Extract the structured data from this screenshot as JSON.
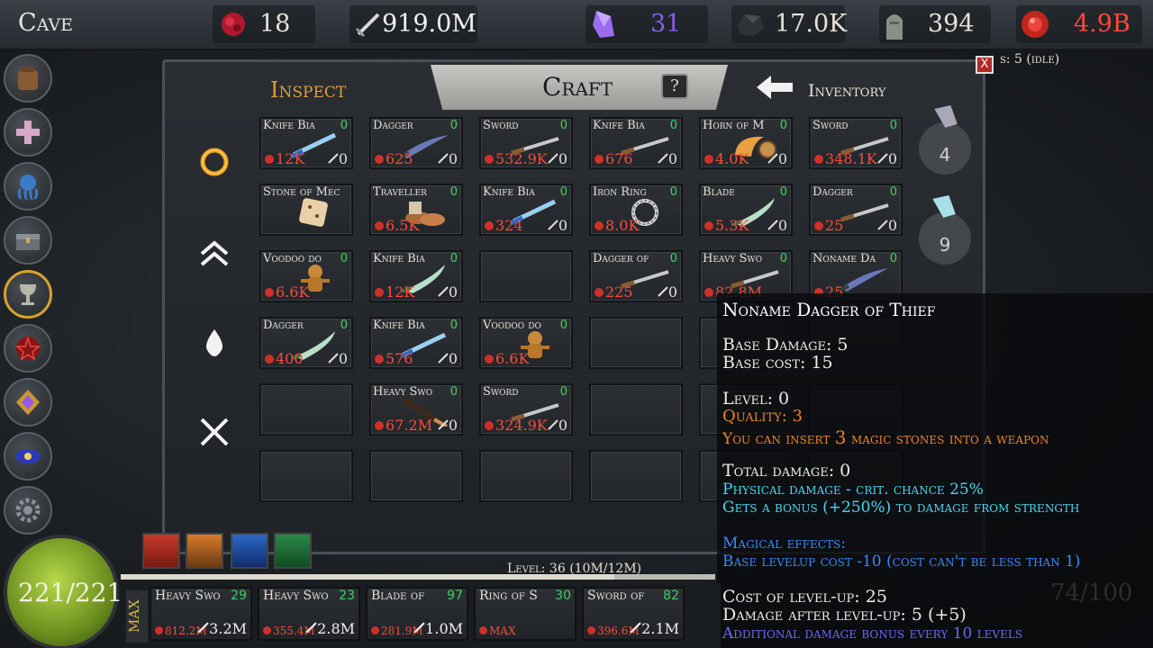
{
  "topbar": {
    "location": "Cave",
    "resources": [
      {
        "icon": "blood-drop-icon",
        "value": "18",
        "color": "#e8e2d6"
      },
      {
        "icon": "sword-icon",
        "value": "919.0M",
        "color": "#f2f2f2"
      },
      {
        "icon": "purple-crystal-icon",
        "value": "31",
        "color": "#8a5cf0"
      },
      {
        "icon": "ore-rock-icon",
        "value": "17.0K",
        "color": "#e8e2d6"
      },
      {
        "icon": "tombstone-icon",
        "value": "394",
        "color": "#e8e2d6"
      },
      {
        "icon": "red-orb-icon",
        "value": "4.9B",
        "color": "#ff4a3a"
      }
    ],
    "status_fragment": "s: 5 (idle)"
  },
  "sidebar": {
    "items": [
      {
        "icon": "backpack-icon"
      },
      {
        "icon": "cross-icon"
      },
      {
        "icon": "octopus-icon"
      },
      {
        "icon": "chest-icon"
      },
      {
        "icon": "goblet-icon",
        "active": true
      },
      {
        "icon": "pentagram-icon"
      },
      {
        "icon": "purple-gem-icon"
      },
      {
        "icon": "galaxy-icon"
      },
      {
        "icon": "gear-icon"
      }
    ]
  },
  "panel": {
    "tabs": {
      "inspect": "Inspect",
      "craft": "Craft",
      "help": "?",
      "inventory": "Inventory"
    },
    "close": "X",
    "actions": [
      "ring-icon",
      "upgrade-chevrons-icon",
      "drop-icon",
      "x-icon"
    ]
  },
  "grid": {
    "rows": [
      [
        {
          "name": "Knife Bia",
          "lvl": "0",
          "cost": "12K",
          "dmg": "0",
          "art": "knife"
        },
        {
          "name": "Dagger",
          "lvl": "0",
          "cost": "625",
          "dmg": "0",
          "art": "dagger"
        },
        {
          "name": "Sword",
          "lvl": "0",
          "cost": "532.9K",
          "dmg": "0",
          "art": "sword"
        },
        {
          "name": "Knife Bia",
          "lvl": "0",
          "cost": "676",
          "dmg": "0",
          "art": "sword"
        },
        {
          "name": "Horn of M",
          "lvl": "0",
          "cost": "4.0K",
          "dmg": "0",
          "art": "horn"
        },
        {
          "name": "Sword",
          "lvl": "0",
          "cost": "348.1K",
          "dmg": "0",
          "art": "sword"
        }
      ],
      [
        {
          "name": "Stone of Mec",
          "lvl": "",
          "cost": "",
          "dmg": "",
          "art": "dice"
        },
        {
          "name": "Traveller",
          "lvl": "0",
          "cost": "6.5K",
          "dmg": "",
          "art": "boots"
        },
        {
          "name": "Knife Bia",
          "lvl": "0",
          "cost": "324",
          "dmg": "0",
          "art": "knife"
        },
        {
          "name": "Iron Ring",
          "lvl": "0",
          "cost": "8.0K",
          "dmg": "",
          "art": "ring"
        },
        {
          "name": "Blade",
          "lvl": "0",
          "cost": "5.3K",
          "dmg": "0",
          "art": "blade"
        },
        {
          "name": "Dagger",
          "lvl": "0",
          "cost": "25",
          "dmg": "0",
          "art": "sword"
        }
      ],
      [
        {
          "name": "Voodoo do",
          "lvl": "0",
          "cost": "6.6K",
          "dmg": "",
          "art": "doll"
        },
        {
          "name": "Knife Bia",
          "lvl": "0",
          "cost": "12K",
          "dmg": "0",
          "art": "blade"
        },
        {
          "name": "",
          "lvl": "",
          "cost": "",
          "dmg": "",
          "art": ""
        },
        {
          "name": "Dagger of",
          "lvl": "0",
          "cost": "225",
          "dmg": "0",
          "art": "sword"
        },
        {
          "name": "Heavy Swo",
          "lvl": "0",
          "cost": "82.8M",
          "dmg": "",
          "art": "sword"
        },
        {
          "name": "Noname Da",
          "lvl": "0",
          "cost": "25",
          "dmg": "",
          "art": "dagger"
        }
      ],
      [
        {
          "name": "Dagger",
          "lvl": "0",
          "cost": "400",
          "dmg": "0",
          "art": "blade"
        },
        {
          "name": "Knife Bia",
          "lvl": "0",
          "cost": "576",
          "dmg": "0",
          "art": "knife"
        },
        {
          "name": "Voodoo do",
          "lvl": "0",
          "cost": "6.6K",
          "dmg": "",
          "art": "doll"
        },
        {
          "name": "",
          "lvl": "",
          "cost": "",
          "dmg": "",
          "art": ""
        },
        {
          "name": "",
          "lvl": "",
          "cost": "",
          "dmg": "",
          "art": ""
        },
        {
          "name": "",
          "lvl": "",
          "cost": "",
          "dmg": "",
          "art": ""
        }
      ],
      [
        {
          "name": "",
          "lvl": "",
          "cost": "",
          "dmg": "",
          "art": ""
        },
        {
          "name": "Heavy Swo",
          "lvl": "0",
          "cost": "67.2M",
          "dmg": "0",
          "art": "club"
        },
        {
          "name": "Sword",
          "lvl": "0",
          "cost": "324.9K",
          "dmg": "0",
          "art": "sword"
        },
        {
          "name": "",
          "lvl": "",
          "cost": "",
          "dmg": "",
          "art": ""
        },
        {
          "name": "",
          "lvl": "",
          "cost": "",
          "dmg": "",
          "art": ""
        },
        {
          "name": "",
          "lvl": "",
          "cost": "",
          "dmg": "",
          "art": ""
        }
      ],
      [
        {
          "name": "",
          "lvl": "",
          "cost": "",
          "dmg": "",
          "art": ""
        },
        {
          "name": "",
          "lvl": "",
          "cost": "",
          "dmg": "",
          "art": ""
        },
        {
          "name": "",
          "lvl": "",
          "cost": "",
          "dmg": "",
          "art": ""
        },
        {
          "name": "",
          "lvl": "",
          "cost": "",
          "dmg": "",
          "art": ""
        },
        {
          "name": "",
          "lvl": "",
          "cost": "",
          "dmg": "",
          "art": ""
        },
        {
          "name": "",
          "lvl": "",
          "cost": "",
          "dmg": "",
          "art": ""
        }
      ]
    ]
  },
  "stones": [
    {
      "count": "4",
      "color": "#a8a8b8"
    },
    {
      "count": "9",
      "color": "#a8e0e8"
    }
  ],
  "tooltip": {
    "title": "Noname Dagger of Thief",
    "base_damage": "Base Damage: 5",
    "base_cost": "Base cost: 15",
    "level": "Level: 0",
    "quality": "Quality: 3",
    "insert_prefix": "You can insert",
    "insert_count": "3",
    "insert_suffix": "magic stones into a weapon",
    "total_damage": "Total damage: 0",
    "physical": "Physical damage - crit. chance 25%",
    "bonus": "Gets a bonus (+250%) to damage from strength",
    "magical_header": "Magical effects:",
    "magical_effect": "Base levelup cost -10 (cost can't be less than 1)",
    "cost_levelup": "Cost of level-up: 25",
    "damage_after": "Damage after level-up: 5 (+5)",
    "additional": "Additional damage bonus every 10 levels"
  },
  "level": {
    "text": "Level: 36 (10M/12M)",
    "progress": 0.83
  },
  "health": {
    "text": "221/221",
    "ghost_text": "74/100"
  },
  "hotbar": {
    "max_label": "MAX",
    "slots": [
      {
        "name": "Heavy Swo",
        "lvl": "29",
        "cost": "812.2M",
        "dmg": "3.2M"
      },
      {
        "name": "Heavy Swo",
        "lvl": "23",
        "cost": "355.4M",
        "dmg": "2.8M"
      },
      {
        "name": "Blade of",
        "lvl": "97",
        "cost": "281.9M",
        "dmg": "1.0M"
      },
      {
        "name": "Ring of S",
        "lvl": "30",
        "cost": "MAX",
        "dmg": ""
      },
      {
        "name": "Sword of",
        "lvl": "82",
        "cost": "396.6M",
        "dmg": "2.1M"
      }
    ]
  }
}
